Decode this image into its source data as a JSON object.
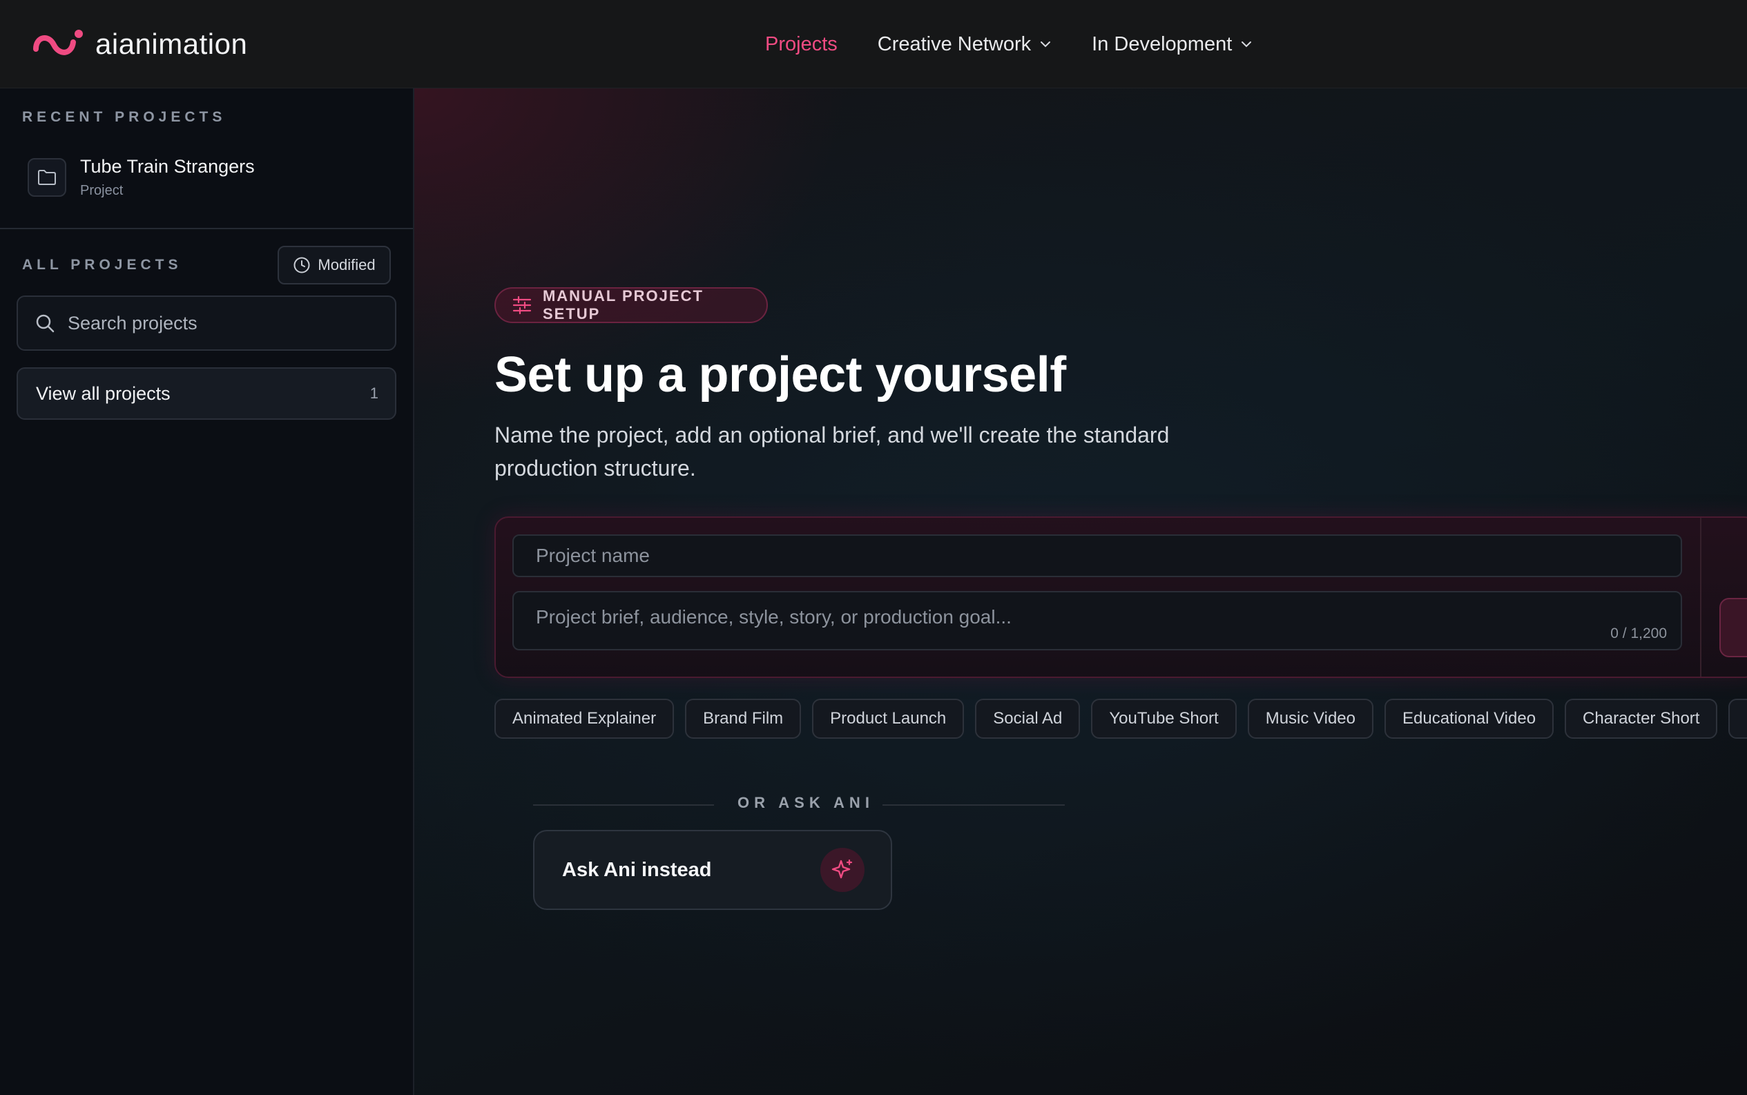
{
  "brand": {
    "name": "aianimation",
    "accent": "#ef4b82"
  },
  "nav": {
    "items": [
      {
        "label": "Projects",
        "active": true,
        "dropdown": false
      },
      {
        "label": "Creative Network",
        "active": false,
        "dropdown": true
      },
      {
        "label": "In Development",
        "active": false,
        "dropdown": true
      }
    ]
  },
  "sidebar": {
    "recent_label": "RECENT PROJECTS",
    "recent": [
      {
        "title": "Tube Train Strangers",
        "subtitle": "Project",
        "icon": "folder-icon"
      }
    ],
    "all_label": "ALL PROJECTS",
    "sort_button": {
      "label": "Modified",
      "icon": "clock-icon"
    },
    "search": {
      "placeholder": "Search projects",
      "value": ""
    },
    "view_all": {
      "label": "View all projects",
      "count": "1"
    }
  },
  "main": {
    "badge": {
      "label": "MANUAL PROJECT SETUP",
      "icon": "sliders-icon"
    },
    "title": "Set up a project yourself",
    "subtitle": "Name the project, add an optional brief, and we'll create the standard production structure.",
    "form": {
      "name_placeholder": "Project name",
      "name_value": "",
      "brief_placeholder": "Project brief, audience, style, story, or production goal...",
      "brief_value": "",
      "counter": "0 / 1,200"
    },
    "chips": [
      "Animated Explainer",
      "Brand Film",
      "Product Launch",
      "Social Ad",
      "YouTube Short",
      "Music Video",
      "Educational Video",
      "Character Short"
    ],
    "divider_label": "OR ASK ANI",
    "ask_button": {
      "label": "Ask Ani instead",
      "icon": "sparkle-icon"
    }
  }
}
